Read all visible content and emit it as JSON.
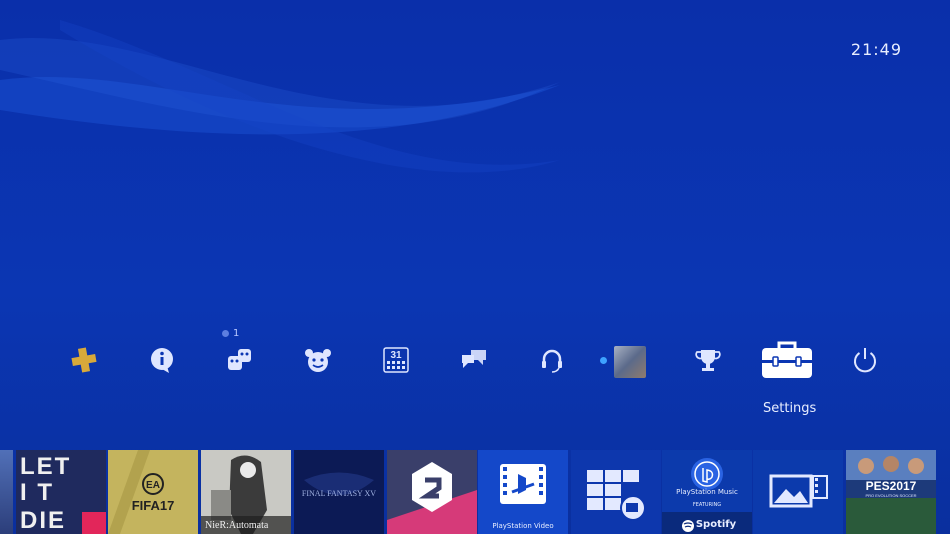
{
  "clock": {
    "time": "21:49"
  },
  "function_area": {
    "selected_label": "Settings",
    "notification_count": "1",
    "items": [
      {
        "name": "playstation-plus",
        "icon": "ps-plus-icon"
      },
      {
        "name": "whats-new",
        "icon": "info-icon"
      },
      {
        "name": "friends",
        "icon": "friends-icon"
      },
      {
        "name": "parties",
        "icon": "party-icon"
      },
      {
        "name": "events",
        "icon": "calendar-icon",
        "text": "31"
      },
      {
        "name": "communities",
        "icon": "speech-bubbles-icon"
      },
      {
        "name": "party-voice",
        "icon": "headset-icon"
      },
      {
        "name": "profile",
        "icon": "avatar-icon"
      },
      {
        "name": "trophies",
        "icon": "trophy-icon"
      },
      {
        "name": "settings",
        "icon": "toolbox-icon"
      },
      {
        "name": "power",
        "icon": "power-icon"
      }
    ]
  },
  "content_tiles": [
    {
      "name": "let-it-die",
      "title": "LET IT DIE"
    },
    {
      "name": "fifa-17",
      "title": "FIFA17",
      "logo": "EA"
    },
    {
      "name": "nier-automata",
      "title": "NieR:Automata"
    },
    {
      "name": "final-fantasy-xv",
      "title": "FINAL FANTASY XV"
    },
    {
      "name": "driveclub",
      "title": ""
    },
    {
      "name": "playstation-video",
      "title": "PlayStation Video"
    },
    {
      "name": "tv-and-video",
      "title": ""
    },
    {
      "name": "playstation-music",
      "title": "PlayStation Music",
      "sub": "FEATURING",
      "brand": "Spotify"
    },
    {
      "name": "capture-gallery",
      "title": ""
    },
    {
      "name": "pes-2017",
      "title": "PES2017",
      "sub": "PRO EVOLUTION SOCCER"
    }
  ],
  "colors": {
    "background": "#0b36b3",
    "accent": "#ffffff",
    "plus_gold": "#e2b23c"
  }
}
